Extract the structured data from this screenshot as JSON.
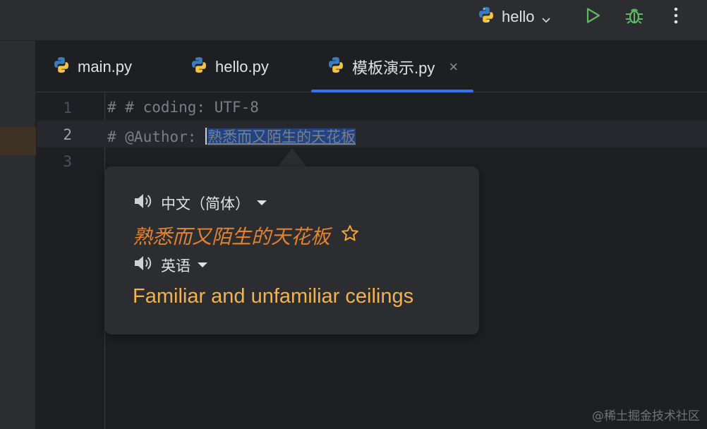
{
  "toolbar": {
    "run_config_label": "hello"
  },
  "tabs": [
    {
      "label": "main.py"
    },
    {
      "label": "hello.py"
    },
    {
      "label": "模板演示.py",
      "close": "×"
    }
  ],
  "editor": {
    "lines": [
      {
        "number": "1",
        "text": "# # coding: UTF-8"
      },
      {
        "number": "2",
        "prefix": "# @Author: ",
        "selected": "熟悉而又陌生的天花板"
      },
      {
        "number": "3",
        "text": ""
      }
    ]
  },
  "popup": {
    "source_lang": "中文（简体）",
    "source_text": "熟悉而又陌生的天花板",
    "target_lang": "英语",
    "target_text": "Familiar and unfamiliar ceilings"
  },
  "watermark": "@稀土掘金技术社区",
  "colors": {
    "accent": "#3574f0",
    "source_text": "#e0822f",
    "target_text": "#f0b34e",
    "run_green": "#5fb865"
  }
}
